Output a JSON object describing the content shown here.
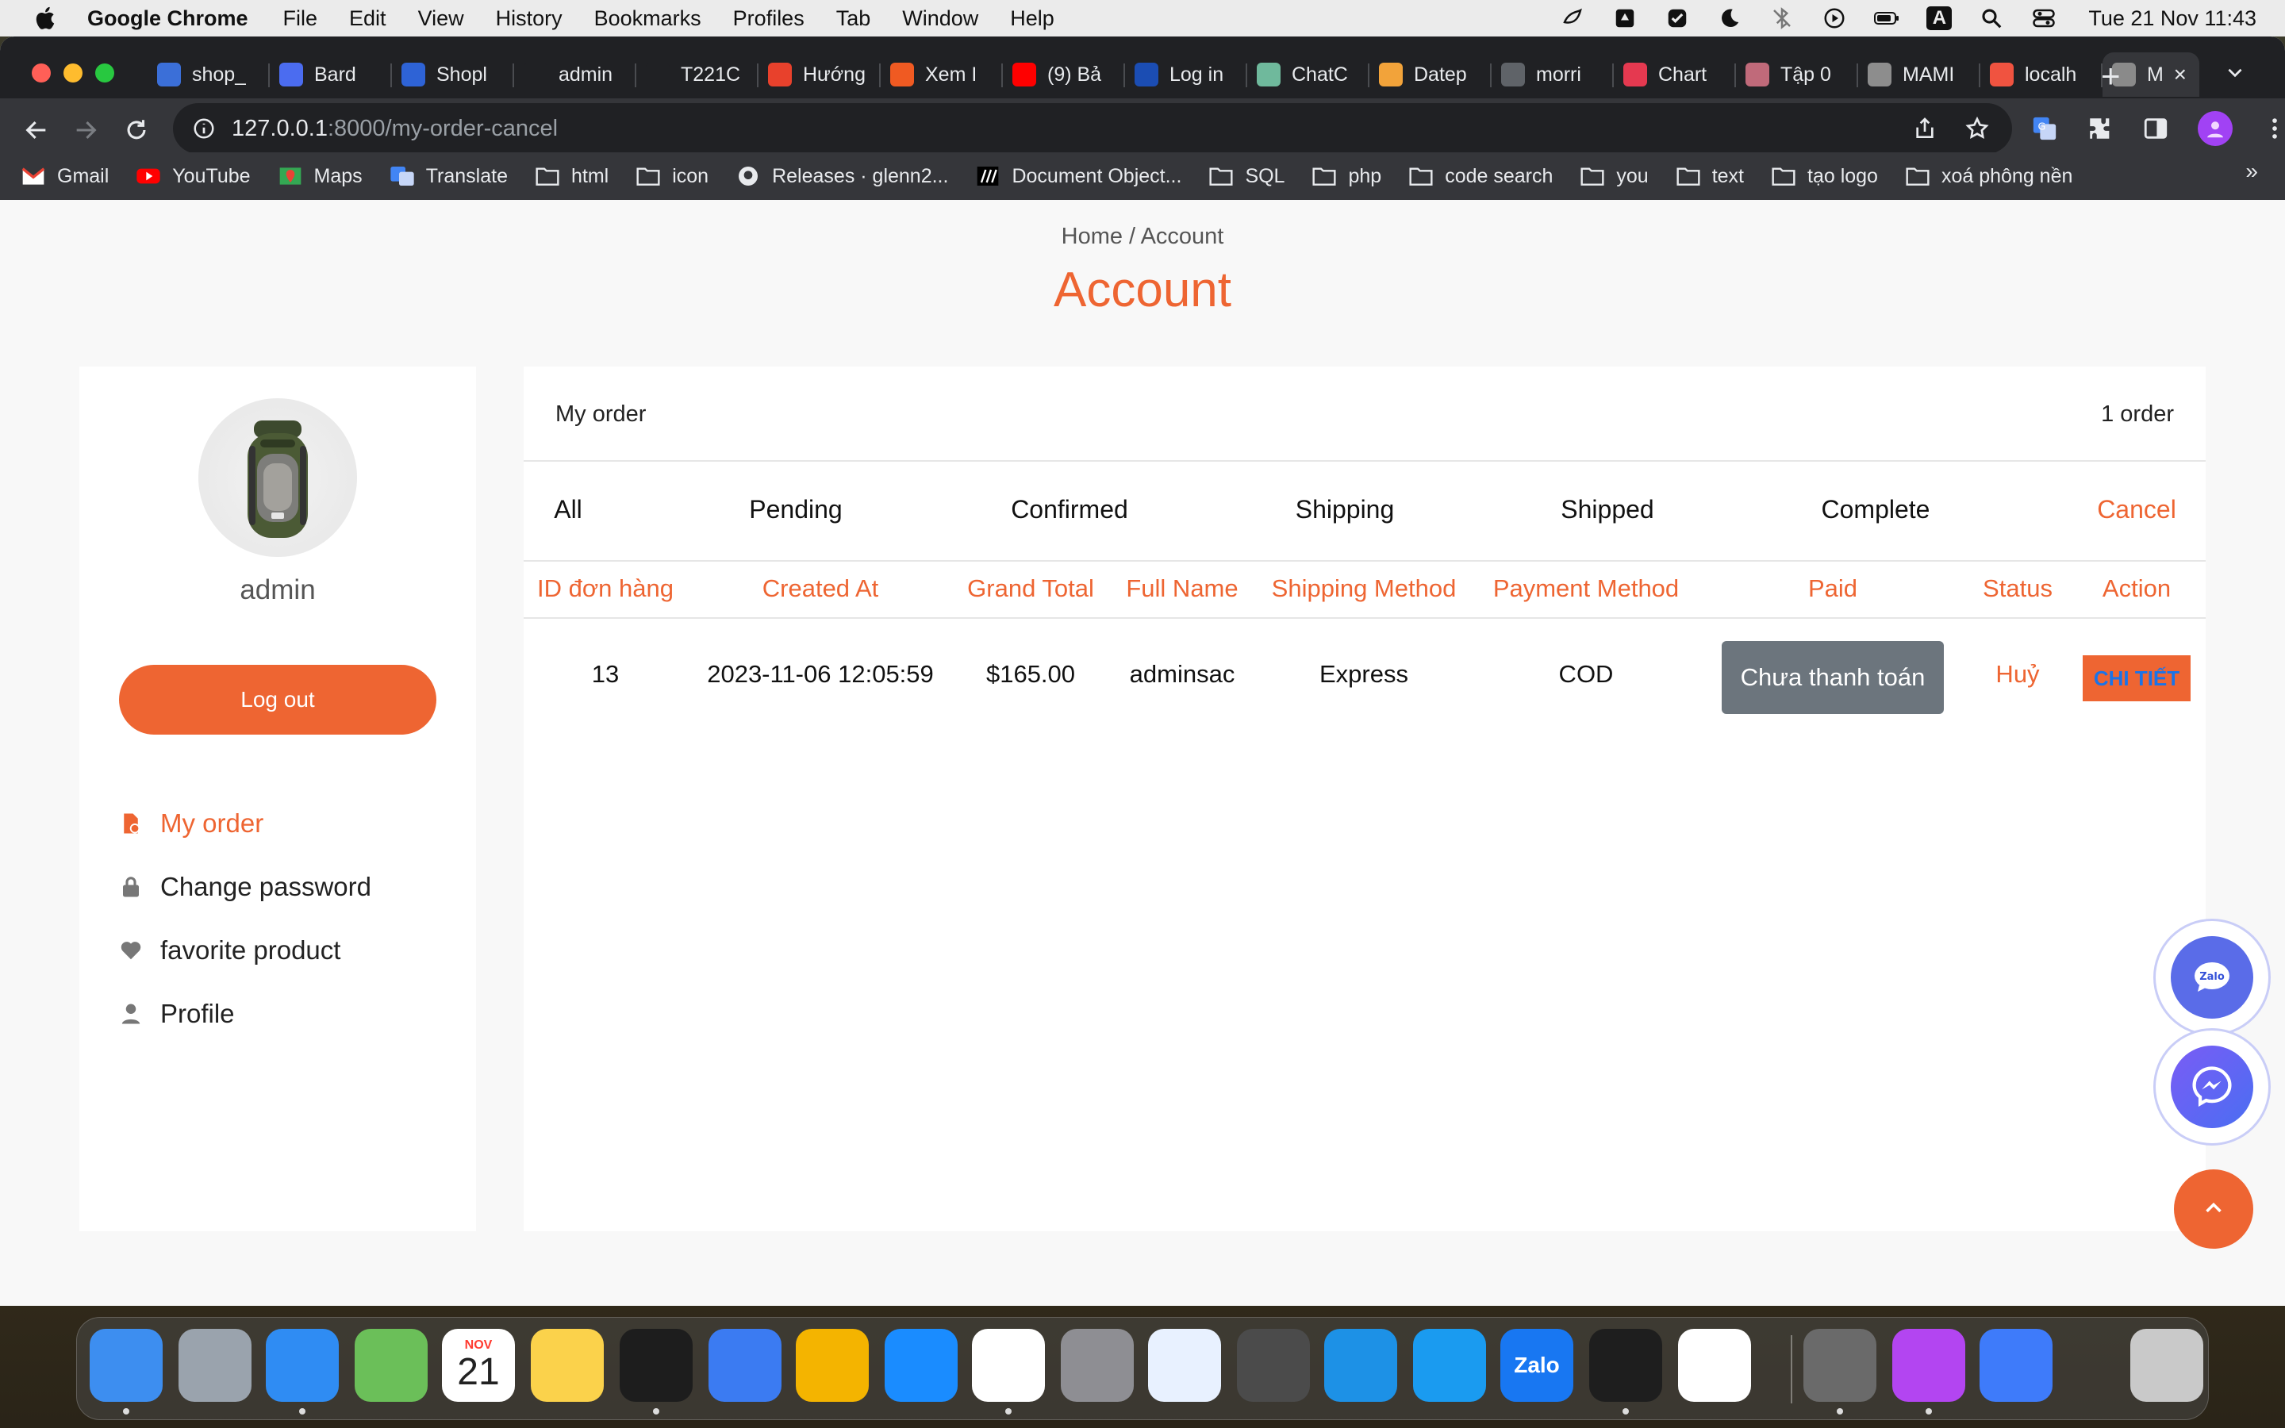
{
  "menubar": {
    "app_name": "Google Chrome",
    "menus": [
      "File",
      "Edit",
      "View",
      "History",
      "Bookmarks",
      "Profiles",
      "Tab",
      "Window",
      "Help"
    ],
    "clock": "Tue 21 Nov  11:43",
    "input_source": "A"
  },
  "browser": {
    "tabs": [
      {
        "label": "shop_",
        "icon": "shop-icon",
        "color": "#3b6fd8"
      },
      {
        "label": "Bard",
        "icon": "bard-icon",
        "color": "#4b6cf0"
      },
      {
        "label": "Shopl",
        "icon": "shop-icon",
        "color": "#2e63d6"
      },
      {
        "label": "admin",
        "icon": "github-icon",
        "color": "#202124"
      },
      {
        "label": "T221C",
        "icon": "github-icon",
        "color": "#202124"
      },
      {
        "label": "Hướng",
        "icon": "brand-icon",
        "color": "#e8412c"
      },
      {
        "label": "Xem I",
        "icon": "play-icon",
        "color": "#f05a22"
      },
      {
        "label": "(9) Bả",
        "icon": "youtube-icon",
        "color": "#ff0000"
      },
      {
        "label": "Log in",
        "icon": "paypal-icon",
        "color": "#1b4db3"
      },
      {
        "label": "ChatC",
        "icon": "chatgpt-icon",
        "color": "#6fb99c"
      },
      {
        "label": "Datep",
        "icon": "datepicker-icon",
        "color": "#f2a33a"
      },
      {
        "label": "morri",
        "icon": "globe-icon",
        "color": "#5f6368"
      },
      {
        "label": "Chart",
        "icon": "chart-icon",
        "color": "#e53950"
      },
      {
        "label": "Tập 0",
        "icon": "anime-icon",
        "color": "#c06a7a"
      },
      {
        "label": "MAMI",
        "icon": "elephant-icon",
        "color": "#8d8d8d"
      },
      {
        "label": "localh",
        "icon": "laravel-icon",
        "color": "#f05340"
      },
      {
        "label": "M",
        "icon": "globe-icon",
        "color": "#8a8a8a",
        "active": true
      }
    ],
    "url_host": "127.0.0.1",
    "url_path": ":8000/my-order-cancel",
    "bookmarks": [
      {
        "label": "Gmail",
        "icon": "gmail-icon"
      },
      {
        "label": "YouTube",
        "icon": "youtube-icon"
      },
      {
        "label": "Maps",
        "icon": "maps-icon"
      },
      {
        "label": "Translate",
        "icon": "translate-icon"
      },
      {
        "label": "html",
        "icon": "folder-icon"
      },
      {
        "label": "icon",
        "icon": "folder-icon"
      },
      {
        "label": "Releases · glenn2...",
        "icon": "github-icon"
      },
      {
        "label": "Document Object...",
        "icon": "mdn-icon"
      },
      {
        "label": "SQL",
        "icon": "folder-icon"
      },
      {
        "label": "php",
        "icon": "folder-icon"
      },
      {
        "label": "code search",
        "icon": "folder-icon"
      },
      {
        "label": "you",
        "icon": "folder-icon"
      },
      {
        "label": "text",
        "icon": "folder-icon"
      },
      {
        "label": "tạo logo",
        "icon": "folder-icon"
      },
      {
        "label": "xoá phông nền",
        "icon": "folder-icon"
      }
    ],
    "bookmarks_more": "»"
  },
  "page": {
    "breadcrumb": "Home / Account",
    "title": "Account",
    "accent_color": "#ee6532",
    "sidebar": {
      "username": "admin",
      "logout_label": "Log out",
      "menu": [
        {
          "label": "My order",
          "icon": "order-icon",
          "active": true
        },
        {
          "label": "Change password",
          "icon": "lock-icon",
          "active": false
        },
        {
          "label": "favorite product",
          "icon": "heart-icon",
          "active": false
        },
        {
          "label": "Profile",
          "icon": "user-icon",
          "active": false
        }
      ]
    },
    "orders": {
      "heading": "My order",
      "count": "1 order",
      "status_tabs": [
        "All",
        "Pending",
        "Confirmed",
        "Shipping",
        "Shipped",
        "Complete",
        "Cancel"
      ],
      "active_tab": "Cancel",
      "columns": [
        "ID đơn hàng",
        "Created At",
        "Grand Total",
        "Full Name",
        "Shipping Method",
        "Payment Method",
        "Paid",
        "Status",
        "Action"
      ],
      "rows": [
        {
          "id": "13",
          "created_at": "2023-11-06 12:05:59",
          "grand_total": "$165.00",
          "full_name": "adminsac",
          "shipping_method": "Express",
          "payment_method": "COD",
          "paid": "Chưa thanh toán",
          "status": "Huỷ",
          "action": "CHI TIẾT"
        }
      ]
    },
    "floating": {
      "zalo_label": "Zalo",
      "scroll_top": "^"
    }
  },
  "dock": {
    "apps": [
      {
        "name": "finder-icon",
        "color": "#3d8ef0"
      },
      {
        "name": "launchpad-icon",
        "color": "#9aa3ad"
      },
      {
        "name": "safari-icon",
        "color": "#2f8cf3"
      },
      {
        "name": "maps-icon",
        "color": "#6bbf59"
      },
      {
        "name": "calendar-icon",
        "color": "#ffffff",
        "month": "NOV",
        "day": "21"
      },
      {
        "name": "notes-icon",
        "color": "#fbd24b"
      },
      {
        "name": "activity-monitor-icon",
        "color": "#1d1d1d"
      },
      {
        "name": "google-docs-icon",
        "color": "#3b7bf2"
      },
      {
        "name": "google-slides-icon",
        "color": "#f4b400"
      },
      {
        "name": "app-store-icon",
        "color": "#1a8cff"
      },
      {
        "name": "chrome-icon",
        "color": "#ffffff"
      },
      {
        "name": "system-settings-icon",
        "color": "#8e8e93"
      },
      {
        "name": "data-icon",
        "color": "#e8f1ff"
      },
      {
        "name": "sublime-text-icon",
        "color": "#4b4b4b"
      },
      {
        "name": "docker-icon",
        "color": "#1d91e6"
      },
      {
        "name": "skype-icon",
        "color": "#1a9bf0"
      },
      {
        "name": "zalo-icon",
        "color": "#1877f2",
        "label": "Zalo"
      },
      {
        "name": "terminal-icon",
        "color": "#1e1e1e"
      },
      {
        "name": "vscode-icon",
        "color": "#ffffff"
      },
      {
        "name": "tableplus-icon",
        "color": "#6a6a6a"
      },
      {
        "name": "phpstorm-icon",
        "color": "#b345f1"
      },
      {
        "name": "warp-icon",
        "color": "#3e7bfa"
      },
      {
        "name": "trash-icon",
        "color": "#c9c9c9"
      }
    ]
  }
}
